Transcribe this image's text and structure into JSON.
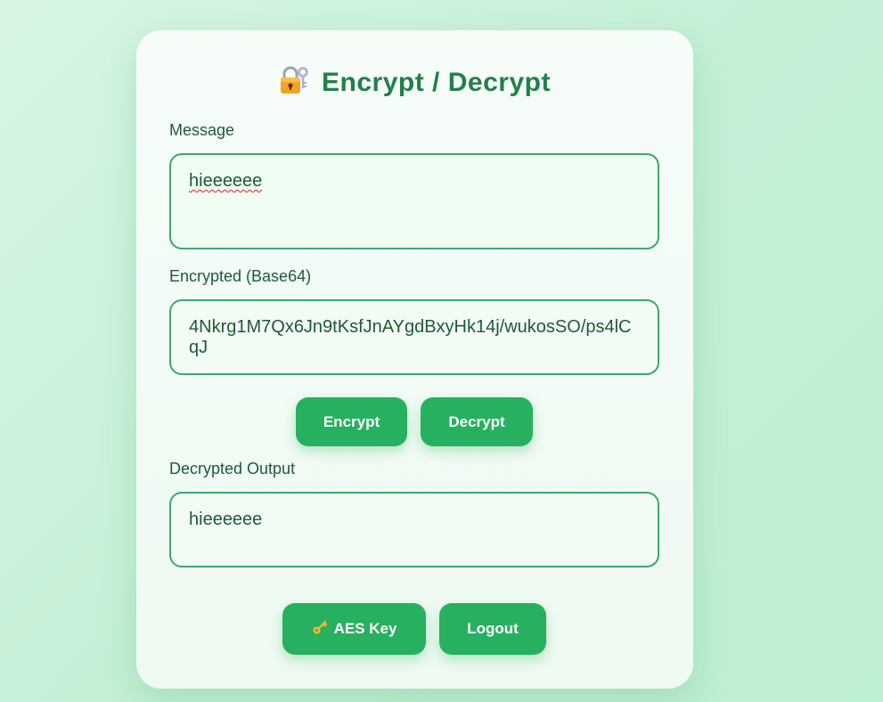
{
  "page": {
    "title": "Encrypt / Decrypt",
    "title_icon": "lock-with-key-icon"
  },
  "message": {
    "label": "Message",
    "value": "hieeeeee"
  },
  "encrypted": {
    "label": "Encrypted (Base64)",
    "value": "4Nkrg1M7Qx6Jn9tKsfJnAYgdBxyHk14j/wukosSO/ps4lCqJ"
  },
  "actions": {
    "encrypt_label": "Encrypt",
    "decrypt_label": "Decrypt"
  },
  "decrypted": {
    "label": "Decrypted Output",
    "value": "hieeeeee"
  },
  "footer": {
    "aes_key_label": "AES Key",
    "aes_key_icon": "key-icon",
    "logout_label": "Logout"
  },
  "colors": {
    "accent": "#27b060",
    "title": "#228049",
    "text": "#1f5a36",
    "border": "#3aaa6a"
  }
}
